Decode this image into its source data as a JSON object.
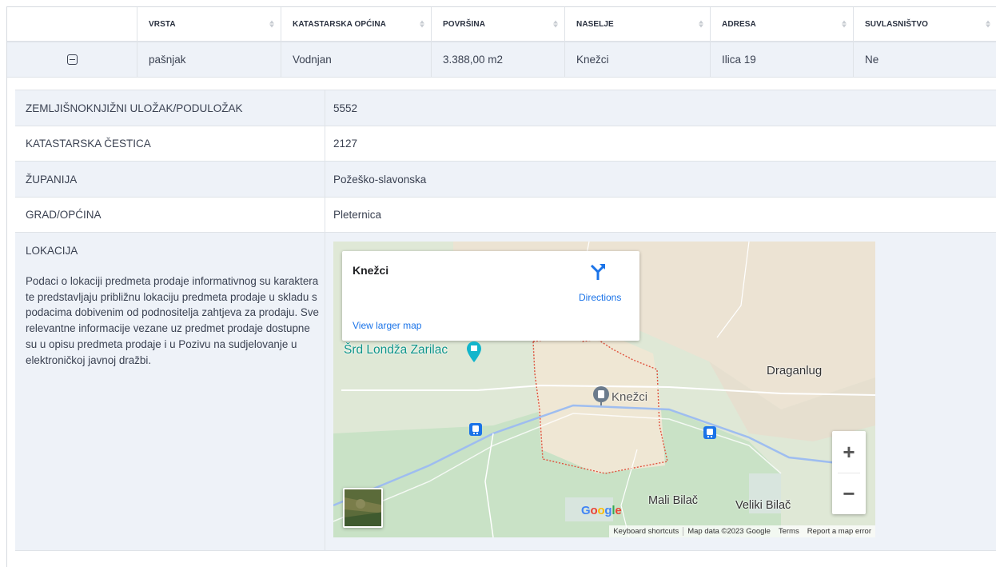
{
  "table": {
    "headers": [
      "",
      "VRSTA",
      "KATASTARSKA OPĆINA",
      "POVRŠINA",
      "NASELJE",
      "ADRESA",
      "SUVLASNIŠTVO"
    ],
    "row": {
      "vrsta": "pašnjak",
      "katastarska_opcina": "Vodnjan",
      "povrsina": "3.388,00 m2",
      "naselje": "Knežci",
      "adresa": "Ilica 19",
      "suvlasnistvo": "Ne"
    }
  },
  "details": {
    "zk_label": "ZEMLJIŠNOKNJIŽNI ULOŽAK/PODULOŽAK",
    "zk_value": "5552",
    "cestica_label": "KATASTARSKA ČESTICA",
    "cestica_value": "2127",
    "zupanija_label": "ŽUPANIJA",
    "zupanija_value": "Požeško-slavonska",
    "grad_label": "GRAD/OPĆINA",
    "grad_value": "Pleternica",
    "lokacija_label": "LOKACIJA",
    "lokacija_text": "Podaci o lokaciji predmeta prodaje informativnog su karaktera te predstavljaju približnu lokaciju predmeta prodaje u skladu s podacima dobivenim od podnositelja zahtjeva za prodaju. Sve relevantne informacije vezane uz predmet prodaje dostupne su u opisu predmeta prodaje i u Pozivu na sudjelovanje u elektroničkoj javnoj dražbi."
  },
  "map": {
    "place_title": "Knežci",
    "directions_label": "Directions",
    "view_larger": "View larger map",
    "labels": {
      "srd": "Šrd Londža Zarilac",
      "draganlug": "Draganlug",
      "knezci": "Knežci",
      "mali_bilac": "Mali Bilač",
      "veliki_bilac": "Veliki Bilač"
    },
    "google_letters": [
      "G",
      "o",
      "o",
      "g",
      "l",
      "e"
    ],
    "zoom_in": "+",
    "zoom_out": "−",
    "attribution": {
      "shortcuts": "Keyboard shortcuts",
      "data": "Map data ©2023 Google",
      "terms": "Terms",
      "report": "Report a map error"
    },
    "colors": {
      "land": "#dfe8d6",
      "forest": "#c9e2c6",
      "urban": "#ece3d3",
      "water": "#9ebdf0",
      "boundary": "#e0533e",
      "link": "#1a73e8"
    }
  }
}
